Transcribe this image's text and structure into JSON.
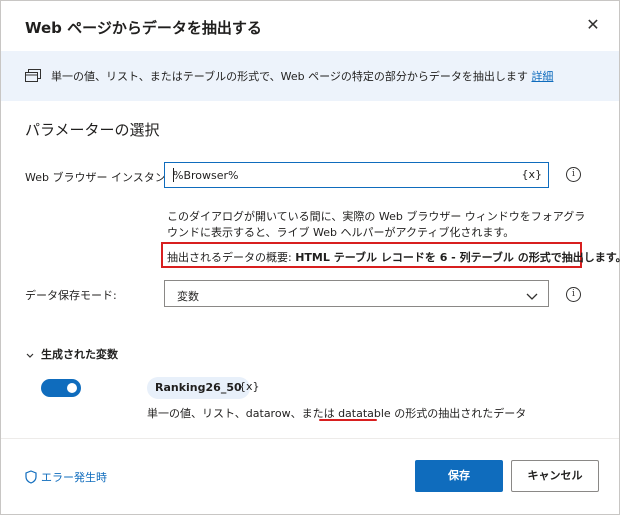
{
  "dialog": {
    "title": "Web ページからデータを抽出する",
    "close_glyph": "✕"
  },
  "infobar": {
    "text": "単一の値、リスト、またはテーブルの形式で、Web ページの特定の部分からデータを抽出します",
    "link": "詳細"
  },
  "section": {
    "title": "パラメーターの選択"
  },
  "browser_instance": {
    "label": "Web ブラウザー インスタンス:",
    "value": "%Browser%",
    "var_button": "{x}",
    "info_glyph": "i"
  },
  "help": {
    "text": "このダイアログが開いている間に、実際の Web ブラウザー ウィンドウをフォアグラウンドに表示すると、ライブ Web ヘルパーがアクティブ化されます。"
  },
  "summary": {
    "prefix": "抽出されるデータの概要: ",
    "bold": "HTML テーブル レコードを 6 - 列テーブル の形式で抽出します。",
    "highlight_color": "#d81f1f"
  },
  "storage_mode": {
    "label": "データ保存モード:",
    "value": "変数",
    "info_glyph": "i"
  },
  "generated_vars": {
    "header": "生成された変数",
    "toggle_on": true,
    "variable_name": "Ranking26_50",
    "var_glyph": "{x}",
    "description_before": "単一の値、リスト、datarow、または ",
    "description_highlight": "datatable",
    "description_after": " の形式の抽出されたデータ"
  },
  "footer": {
    "error_link": "エラー発生時",
    "save": "保存",
    "cancel": "キャンセル"
  },
  "colors": {
    "accent": "#0f6cbd",
    "infobar_bg": "#edf3fb",
    "highlight": "#d81f1f"
  }
}
